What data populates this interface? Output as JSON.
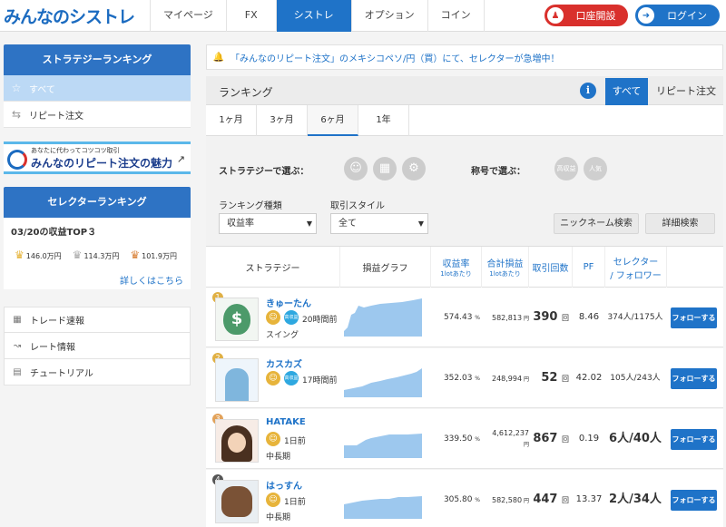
{
  "header": {
    "logo": "みんなのシストレ",
    "nav": [
      "マイページ",
      "FX",
      "シストレ",
      "オプション",
      "コイン"
    ],
    "open_account": "口座開設",
    "login": "ログイン"
  },
  "sidebar": {
    "strategy_ranking_title": "ストラテジーランキング",
    "items": [
      {
        "label": "すべて",
        "icon": "star-icon"
      },
      {
        "label": "リピート注文",
        "icon": "repeat-icon"
      }
    ],
    "banner_small": "あなたに代わってコツコツ取引",
    "banner_big": "みんなのリピート注文の魅力",
    "selector_ranking_title": "セレクターランキング",
    "selector_date": "03/20の収益TOP３",
    "crowns": [
      {
        "value": "146.0万円",
        "color": "#e6b43a"
      },
      {
        "value": "114.3万円",
        "color": "#a9a9a9"
      },
      {
        "value": "101.9万円",
        "color": "#d9823a"
      }
    ],
    "more_link": "詳しくはこちら",
    "menu": [
      "トレード速報",
      "レート情報",
      "チュートリアル"
    ]
  },
  "notice": "「みんなのリピート注文」のメキシコペソ/円（買）にて、セレクターが急増中！",
  "ranking": {
    "title": "ランキング",
    "seg_all": "すべて",
    "seg_repeat": "リピート注文",
    "periods": [
      "1ヶ月",
      "3ヶ月",
      "6ヶ月",
      "1年"
    ],
    "active_period": 2
  },
  "filters": {
    "by_strategy": "ストラテジーで選ぶ：",
    "by_title": "称号で選ぶ：",
    "badge_1": "高収益",
    "badge_2": "人気",
    "ranking_type_label": "ランキング種類",
    "ranking_type_value": "収益率",
    "trade_style_label": "取引スタイル",
    "trade_style_value": "全て",
    "nickname_search": "ニックネーム検索",
    "detail_search": "詳細検索"
  },
  "table": {
    "headers": {
      "strategy": "ストラテジー",
      "graph": "損益グラフ",
      "profit_rate": "収益率",
      "profit_rate_sub": "1lotあたり",
      "total": "合計損益",
      "total_sub": "1lotあたり",
      "count": "取引回数",
      "pf": "PF",
      "selector": "セレクター",
      "follower": "/ フォロワー"
    },
    "rows": [
      {
        "rank": "1",
        "name": "きゅーたん",
        "since": "20時間前",
        "type": "スイング",
        "profit": "574.43",
        "total": "582,813",
        "count": "390",
        "pf": "8.46",
        "sel": "374人/1175人",
        "big": false,
        "badge": true
      },
      {
        "rank": "2",
        "name": "カスカズ",
        "since": "17時間前",
        "type": "",
        "profit": "352.03",
        "total": "248,994",
        "count": "52",
        "pf": "42.02",
        "sel": "105人/243人",
        "big": false,
        "badge": true
      },
      {
        "rank": "3",
        "name": "HATAKE",
        "since": "1日前",
        "type": "中長期",
        "profit": "339.50",
        "total": "4,612,237",
        "count": "867",
        "pf": "0.19",
        "sel": "6人/40人",
        "big": true,
        "badge": false
      },
      {
        "rank": "4",
        "name": "はっすん",
        "since": "1日前",
        "type": "中長期",
        "profit": "305.80",
        "total": "582,580",
        "count": "447",
        "pf": "13.37",
        "sel": "2人/34人",
        "big": true,
        "badge": false
      }
    ],
    "pct": "%",
    "yen": "円",
    "times": "回",
    "follow": "フォローする"
  }
}
